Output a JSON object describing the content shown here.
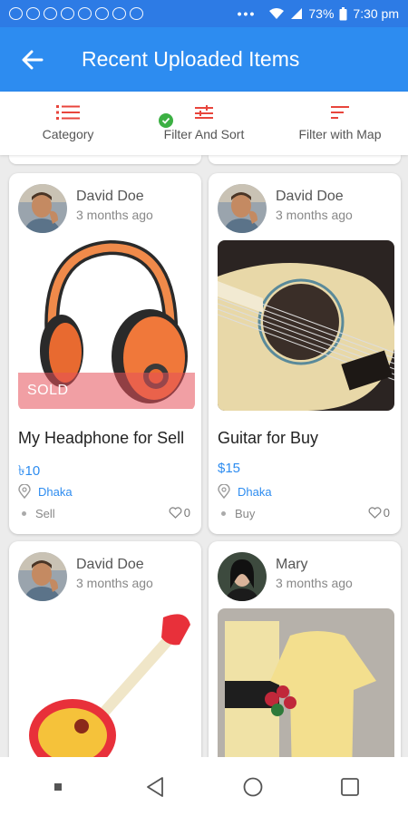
{
  "status_bar": {
    "battery": "73%",
    "time": "7:30 pm",
    "dots": "•••"
  },
  "app_bar": {
    "title": "Recent Uploaded Items",
    "back_icon": "arrow-left-icon"
  },
  "filters": [
    {
      "label": "Category",
      "icon": "list-icon"
    },
    {
      "label": "Filter And Sort",
      "icon": "sliders-icon",
      "active": true
    },
    {
      "label": "Filter with Map",
      "icon": "sort-lines-icon"
    }
  ],
  "items": [
    {
      "owner": "David Doe",
      "time": "3 months ago",
      "sold_label": "SOLD",
      "title": "My Headphone for Sell",
      "price": "৳10",
      "location": "Dhaka",
      "type": "Sell",
      "likes": "0"
    },
    {
      "owner": "David Doe",
      "time": "3 months ago",
      "title": "Guitar for Buy",
      "price": "$15",
      "location": "Dhaka",
      "type": "Buy",
      "likes": "0"
    },
    {
      "owner": "David Doe",
      "time": "3 months ago"
    },
    {
      "owner": "Mary",
      "time": "3 months ago"
    }
  ],
  "colors": {
    "primary": "#2d8cf0",
    "status_bar": "#2d7be5",
    "accent_red": "#e8453c",
    "check_green": "#3cb043",
    "sold_band": "#e6505a"
  }
}
